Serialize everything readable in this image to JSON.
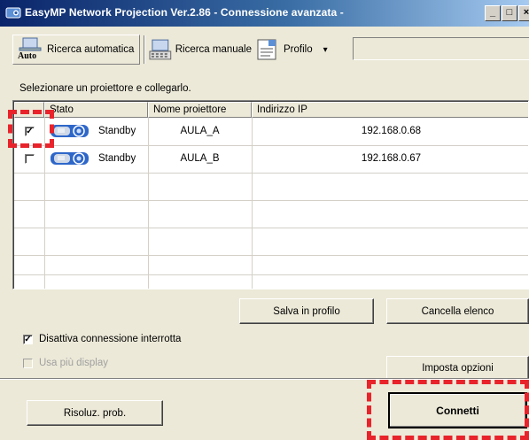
{
  "window": {
    "title": "EasyMP Network Projection Ver.2.86 - Connessione avanzata -",
    "min_label": "_",
    "max_label": "□",
    "close_label": "×"
  },
  "toolbar": {
    "auto_search_label": "Ricerca automatica",
    "auto_icon_text": "Auto",
    "manual_search_label": "Ricerca manuale",
    "profile_label": "Profilo",
    "profile_arrow": "▾",
    "profile_value": ""
  },
  "instruction": "Selezionare un proiettore e collegarlo.",
  "table": {
    "columns": [
      "Stato",
      "Nome proiettore",
      "Indirizzo IP"
    ],
    "rows": [
      {
        "checked": true,
        "status": "Standby",
        "name": "AULA_A",
        "ip": "192.168.0.68"
      },
      {
        "checked": false,
        "status": "Standby",
        "name": "AULA_B",
        "ip": "192.168.0.67"
      }
    ]
  },
  "buttons": {
    "save_profile": "Salva in profilo",
    "clear_list": "Cancella elenco",
    "set_options": "Imposta opzioni",
    "troubleshoot": "Risoluz. prob.",
    "connect": "Connetti"
  },
  "options": {
    "disable_interrupted": {
      "label": "Disattiva connessione interrotta",
      "checked": true
    },
    "multi_display": {
      "label": "Usa più display",
      "checked": false,
      "enabled": false
    }
  },
  "colors": {
    "annotation": "#e8232b",
    "titlebar_start": "#0a246a",
    "titlebar_end": "#a6caf0",
    "window_bg": "#ece9d8"
  },
  "check_glyph": "✓"
}
